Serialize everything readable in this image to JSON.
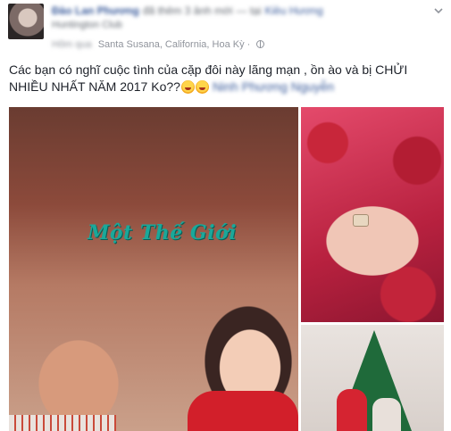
{
  "post": {
    "author": "Đào Lan Phương",
    "header_mid": "đã thêm 3 ảnh mới",
    "tag_prefix": "— tại",
    "tag_place": "Kiều Hương",
    "header_line2": "Huntington Club",
    "location": "Santa Susana, California, Hoa Kỳ",
    "separator": "·",
    "text": "Các bạn có nghĩ cuộc tình của cặp đôi này lãng mạn , ồn ào và bị CHỬI NHIỀU NHẤT NĂM 2017 Ko??",
    "mention": "Ninh Phương Nguyễn"
  },
  "photos": {
    "main_watermark": "Một Thế Giới"
  },
  "icons": {
    "menu": "chevron-down-icon",
    "privacy": "globe-icon",
    "emoji": "laughing-emoji-icon"
  },
  "colors": {
    "link": "#365899",
    "meta": "#90949c",
    "text": "#1d2129",
    "watermark": "#1aa89a"
  }
}
